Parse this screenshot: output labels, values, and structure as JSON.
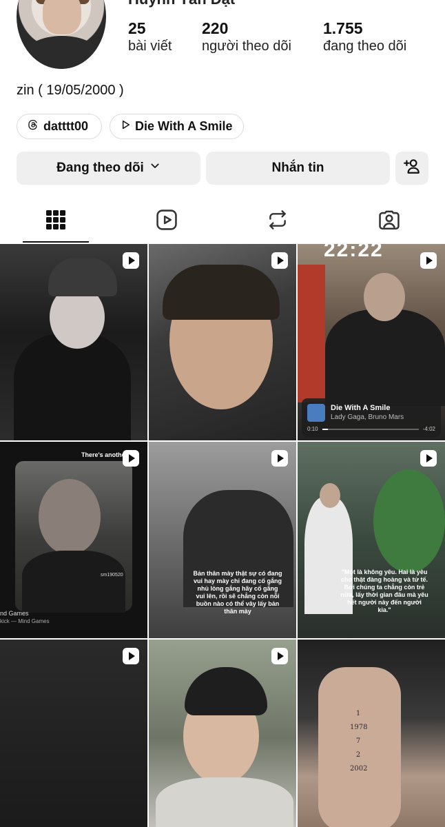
{
  "profile": {
    "username_partial": "Huỳnh Tấn Đạt",
    "bio": "zin ( 19/05/2000 )"
  },
  "stats": {
    "posts": {
      "value": "25",
      "label": "bài viết"
    },
    "followers": {
      "value": "220",
      "label": "người theo dõi"
    },
    "following": {
      "value": "1.755",
      "label": "đang theo dõi"
    }
  },
  "links": {
    "threads": "datttt00",
    "music": "Die With A Smile"
  },
  "actions": {
    "following_label": "Đang theo dõi",
    "message_label": "Nhắn tin"
  },
  "tabs": [
    {
      "icon": "grid-icon",
      "active": true
    },
    {
      "icon": "reels-icon",
      "active": false
    },
    {
      "icon": "repost-icon",
      "active": false
    },
    {
      "icon": "tagged-icon",
      "active": false
    }
  ],
  "posts": {
    "p3": {
      "overlay": "22:22",
      "song_title": "Die With A Smile",
      "song_artist": "Lady Gaga, Bruno Mars",
      "time_start": "0:10",
      "time_end": "-4:02"
    },
    "p4": {
      "top_text": "There's another",
      "tag": "sm190520",
      "line1": "nd Games",
      "line2": "kick — Mind Games"
    },
    "p5": {
      "quote": "Bản thân mày thật sự có đang vui hay mày chỉ đang cố gắng nhủ lòng gắng hãy cố gắng vui lên, rồi sẽ chẳng còn nỗi buồn nào có thể vây lấy bản thân mày"
    },
    "p6": {
      "quote": "\"Một là không yêu. Hai là yêu cho thật đàng hoàng và tử tế. Bởi chúng ta chẳng còn trẻ nữa, lấy thời gian đâu mà yêu hết người này đến người kia.\""
    },
    "p9": {
      "tattoo": [
        "1",
        "1978",
        "7",
        "2",
        "2002"
      ]
    }
  },
  "colors": {
    "button_bg": "#efefef",
    "text": "#111111",
    "chip_border": "#dcdcdc"
  }
}
